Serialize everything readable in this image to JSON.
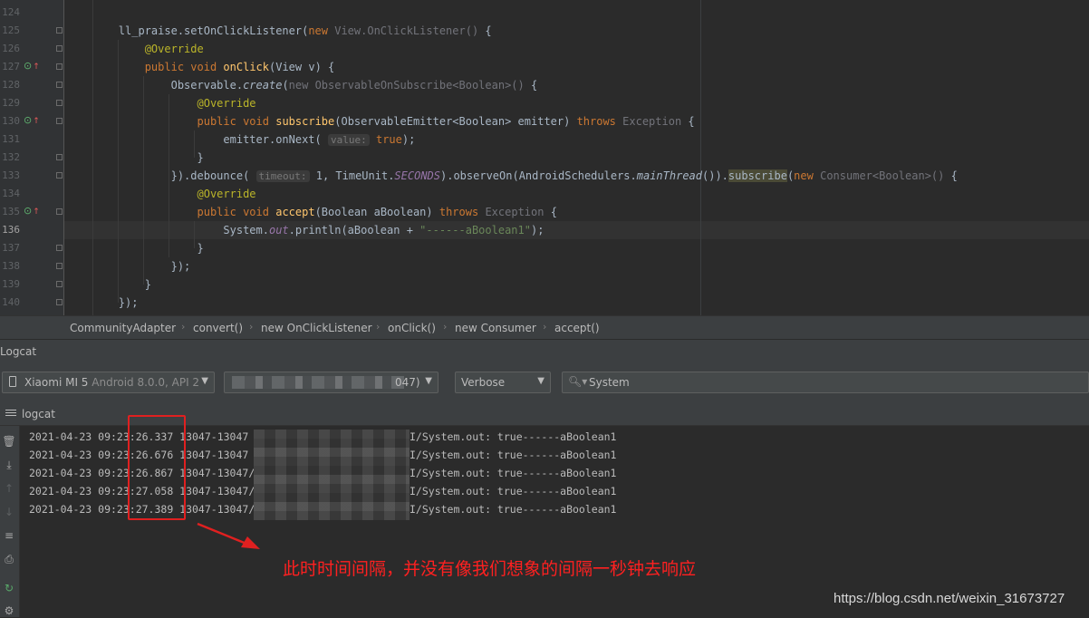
{
  "editor": {
    "current_line": "136",
    "lines": [
      {
        "n": "124",
        "override": false,
        "fold": false,
        "html": ""
      },
      {
        "n": "125",
        "override": false,
        "fold": true,
        "html": "        ll_praise.setOnClickListener(<span class=\"kw\">new</span> <span class=\"dim\">View.OnClickListener()</span> {"
      },
      {
        "n": "126",
        "override": false,
        "fold": true,
        "html": "            <span class=\"ann\">@Override</span>"
      },
      {
        "n": "127",
        "override": true,
        "fold": true,
        "html": "            <span class=\"kw\">public void</span> <span class=\"fn\">onClick</span>(View v) {"
      },
      {
        "n": "128",
        "override": false,
        "fold": true,
        "html": "                Observable.<span class=\"ital\">create</span>(<span class=\"dim\">new ObservableOnSubscribe&lt;Boolean&gt;()</span> {"
      },
      {
        "n": "129",
        "override": false,
        "fold": true,
        "html": "                    <span class=\"ann\">@Override</span>"
      },
      {
        "n": "130",
        "override": true,
        "fold": true,
        "html": "                    <span class=\"kw\">public void</span> <span class=\"fn\">subscribe</span>(ObservableEmitter&lt;Boolean&gt; emitter) <span class=\"kw\">throws</span> <span class=\"dim\">Exception</span> {"
      },
      {
        "n": "131",
        "override": false,
        "fold": false,
        "html": "                        emitter.onNext( <span class=\"hint\">value:</span> <span class=\"kw\">true</span>);"
      },
      {
        "n": "132",
        "override": false,
        "fold": true,
        "html": "                    }"
      },
      {
        "n": "133",
        "override": false,
        "fold": true,
        "html": "                }).debounce( <span class=\"hint\">timeout:</span> 1, TimeUnit.<span class=\"field\">SECONDS</span>).observeOn(AndroidSchedulers.<span class=\"ital\">mainThread</span>()).<span class=\"hl\">subscribe</span>(<span class=\"kw\">new</span> <span class=\"dim\">Consumer&lt;Boolean&gt;()</span> {"
      },
      {
        "n": "134",
        "override": false,
        "fold": false,
        "html": "                    <span class=\"ann\">@Override</span>"
      },
      {
        "n": "135",
        "override": true,
        "fold": true,
        "html": "                    <span class=\"kw\">public void</span> <span class=\"fn\">accept</span>(Boolean aBoolean) <span class=\"kw\">throws</span> <span class=\"dim\">Exception</span> {"
      },
      {
        "n": "136",
        "override": false,
        "fold": false,
        "html": "                        System.<span class=\"field\">out</span>.println(aBoolean + <span class=\"str\">\"------aBoolean1\"</span>);"
      },
      {
        "n": "137",
        "override": false,
        "fold": true,
        "html": "                    }"
      },
      {
        "n": "138",
        "override": false,
        "fold": true,
        "html": "                });"
      },
      {
        "n": "139",
        "override": false,
        "fold": true,
        "html": "            }"
      },
      {
        "n": "140",
        "override": false,
        "fold": true,
        "html": "        });"
      }
    ]
  },
  "breadcrumb": [
    "CommunityAdapter",
    "convert()",
    "new OnClickListener",
    "onClick()",
    "new Consumer",
    "accept()"
  ],
  "logcat": {
    "title": "Logcat",
    "device": {
      "name": "Xiaomi MI 5",
      "detail": "Android 8.0.0, API 2"
    },
    "process_tail": "047)",
    "level": "Verbose",
    "search": "System",
    "tab_label": "logcat",
    "lines": [
      {
        "date": "2021-04-23 09:23:26.337 13047-13047",
        "msg": "I/System.out: true------aBoolean1"
      },
      {
        "date": "2021-04-23 09:23:26.676 13047-13047",
        "msg": "I/System.out: true------aBoolean1"
      },
      {
        "date": "2021-04-23 09:23:26.867 13047-13047/",
        "msg": "I/System.out: true------aBoolean1"
      },
      {
        "date": "2021-04-23 09:23:27.058 13047-13047/",
        "msg": "I/System.out: true------aBoolean1"
      },
      {
        "date": "2021-04-23 09:23:27.389 13047-13047/",
        "msg": "I/System.out: true------aBoolean1"
      }
    ]
  },
  "annotation": {
    "text": "此时时间间隔，并没有像我们想象的间隔一秒钟去响应",
    "color": "#ff2020"
  },
  "watermark": "https://blog.csdn.net/weixin_31673727",
  "icons": [
    "override-icon",
    "fold-icon",
    "phone-icon",
    "dropdown-arrow-icon",
    "search-icon",
    "trash-icon",
    "scroll-to-end-icon",
    "up-arrow-icon",
    "down-arrow-icon",
    "soft-wrap-icon",
    "print-icon",
    "restart-icon",
    "settings-icon"
  ]
}
